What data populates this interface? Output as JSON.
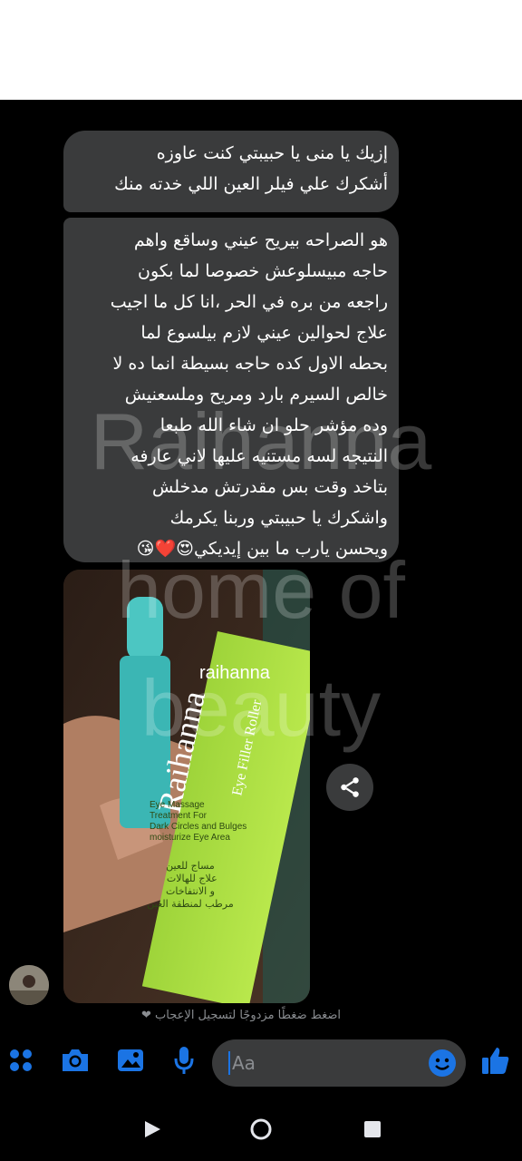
{
  "messages": [
    {
      "id": "m1",
      "text": "إزيك يا منى يا حبيبتي كنت عاوزه\nأشكرك علي فيلر العين اللي  خدته منك"
    },
    {
      "id": "m2",
      "text": "هو الصراحه بيريح عيني وساقع واهم\nحاجه مبيسلوعش خصوصا لما بكون\nراجعه من بره في الحر ،انا كل ما اجيب\nعلاج لحوالين عيني لازم بيلسوع لما\nبحطه الاول كده حاجه بسيطة انما ده لا\nخالص السيرم بارد ومريح وملسعنيش\nوده مؤشر حلو ان شاء الله طبعا\nالنتيجه لسه مستنيه عليها لاني عارفه\nبتاخد وقت بس مقدرتش مدخلش\nواشكرك يا حبيبتي وربنا يكرمك\nويحسن يارب ما بين إيديكي😍❤️😘"
    }
  ],
  "photo": {
    "box_brand": "Raihanna",
    "box_product": "Eye Filler Roller",
    "box_logo": "raihanna",
    "box_en_text": "Eye Massage\nTreatment For\nDark Circles and Bulges\nmoisturize Eye Area",
    "box_ar_text": "مساج للعين\nعلاج للهالات\nو الانتفاخات\nمرطب لمنطقة العين"
  },
  "watermark": {
    "line1": "Raihanna",
    "line2": "home of",
    "line3": "beauty"
  },
  "hint_text": "اضغط ضغطًا مزدوجًا لتسجيل الإعجاب ❤",
  "composer": {
    "placeholder": "Aa",
    "icons": [
      "apps-icon",
      "camera-icon",
      "gallery-icon",
      "microphone-icon",
      "emoji-icon",
      "like-icon"
    ],
    "accent_color": "#1b74e4"
  },
  "navbar": {
    "icons": [
      "back-triangle-icon",
      "home-circle-icon",
      "recents-square-icon"
    ]
  }
}
